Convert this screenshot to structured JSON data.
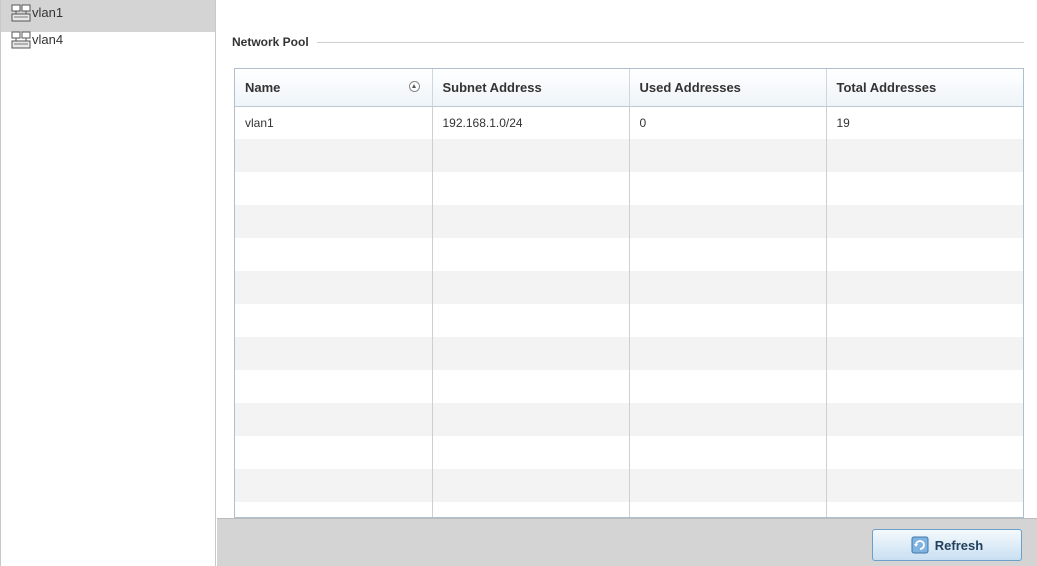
{
  "sidebar": {
    "items": [
      {
        "label": "vlan1",
        "icon": "network-icon",
        "selected": true
      },
      {
        "label": "vlan4",
        "icon": "network-icon",
        "selected": false
      }
    ]
  },
  "main": {
    "group_title": "Network Pool",
    "table": {
      "columns": [
        "Name",
        "Subnet Address",
        "Used Addresses",
        "Total Addresses"
      ],
      "sort_icon": "sort-ascending-icon",
      "rows": [
        [
          "vlan1",
          "192.168.1.0/24",
          "0",
          "19"
        ]
      ]
    }
  },
  "footer": {
    "refresh_label": "Refresh",
    "refresh_icon": "refresh-icon"
  },
  "colors": {
    "selected_row": "#d4d4d4",
    "footer_bg": "#d4d4d4",
    "button_border": "#6e9fc8",
    "grid_border": "#aebfd0"
  }
}
